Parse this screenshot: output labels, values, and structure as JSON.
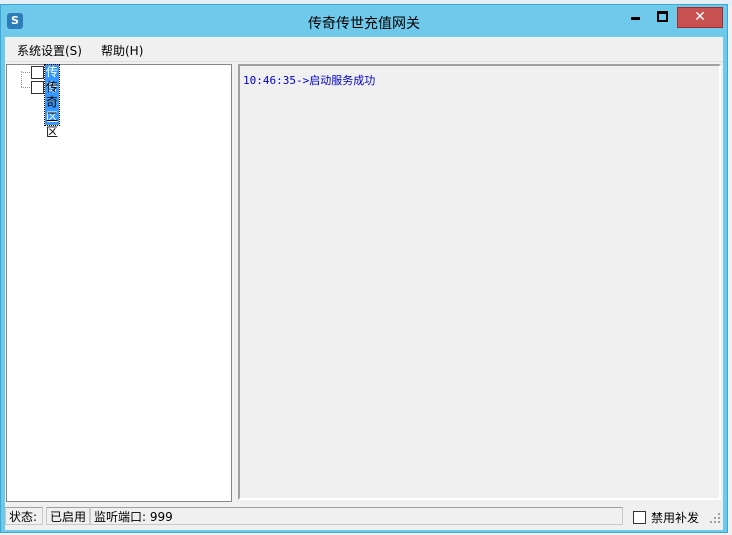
{
  "window": {
    "title": "传奇传世充值网关",
    "icon": "shield-app-icon",
    "controls": {
      "minimize": "minimize-icon",
      "maximize": "maximize-icon",
      "close": "✕"
    }
  },
  "menu": [
    {
      "label": "系统设置(S)"
    },
    {
      "label": "帮助(H)"
    }
  ],
  "tree": {
    "nodes": [
      {
        "label": "传奇一区",
        "checked": false,
        "selected": true
      },
      {
        "label": "传奇二区",
        "checked": false,
        "selected": false
      }
    ]
  },
  "log": {
    "lines": [
      "10:46:35->启动服务成功"
    ],
    "text_color": "#0000cc"
  },
  "status": {
    "state_label": "状态:",
    "state_value": "已启用",
    "port_text": "监听端口: 999",
    "disable_label": "禁用补发",
    "disable_checked": false
  },
  "colors": {
    "titlebar": "#6ec9ea",
    "close_button": "#c75050",
    "selection": "#3399ff"
  }
}
